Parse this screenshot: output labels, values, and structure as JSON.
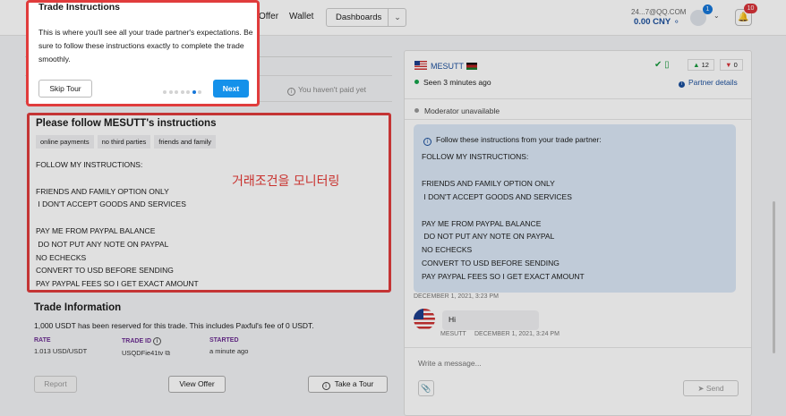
{
  "topbar": {
    "nav_offer": "Offer",
    "nav_wallet": "Wallet",
    "dashboards_label": "Dashboards",
    "account": "24...7@QQ.COM",
    "balance": "0.00 CNY",
    "avatar_badge": "1",
    "notifications_badge": "10"
  },
  "left": {
    "unpaid": "You haven't paid yet",
    "instructions_title": "Please follow MESUTT's instructions",
    "tags": [
      "online payments",
      "no third parties",
      "friends and family"
    ],
    "instructions_text": "FOLLOW MY INSTRUCTIONS:\n\nFRIENDS AND FAMILY OPTION ONLY\n I DON'T ACCEPT GOODS AND SERVICES\n\nPAY ME FROM PAYPAL BALANCE\n DO NOT PUT ANY NOTE ON PAYPAL\nNO ECHECKS\nCONVERT TO USD BEFORE SENDING\nPAY PAYPAL FEES SO I GET EXACT AMOUNT",
    "annotation": "거래조건을 모니터링",
    "trade_info_title": "Trade Information",
    "trade_info_desc": "1,000 USDT has been reserved for this trade. This includes Paxful's fee of 0 USDT.",
    "rate_label": "RATE",
    "rate_value": "1.013 USD/USDT",
    "trade_id_label": "TRADE ID",
    "trade_id_value": "USQDFie41tv",
    "started_label": "STARTED",
    "started_value": "a minute ago",
    "report_btn": "Report",
    "view_offer_btn": "View Offer",
    "take_tour_btn": "Take a Tour"
  },
  "right": {
    "partner_name": "MESUTT",
    "seen": "Seen 3 minutes ago",
    "thumbs_up": "12",
    "thumbs_down": "0",
    "partner_details": "Partner details",
    "moderator": "Moderator unavailable",
    "chat_header": "Follow these instructions from your trade partner:",
    "chat_body": "FOLLOW MY INSTRUCTIONS:\n\nFRIENDS AND FAMILY OPTION ONLY\n I DON'T ACCEPT GOODS AND SERVICES\n\nPAY ME FROM PAYPAL BALANCE\n DO NOT PUT ANY NOTE ON PAYPAL\nNO ECHECKS\nCONVERT TO USD BEFORE SENDING\nPAY PAYPAL FEES SO I GET EXACT AMOUNT",
    "chat_timestamp": "DECEMBER 1, 2021, 3:23 PM",
    "message_text": "Hi",
    "message_sender": "MESUTT",
    "message_time": "DECEMBER 1, 2021, 3:24 PM",
    "compose_placeholder": "Write a message...",
    "send_btn": "Send"
  },
  "tour": {
    "title": "Trade Instructions",
    "text": "This is where you'll see all your trade partner's expectations. Be sure to follow these instructions exactly to complete the trade smoothly.",
    "skip_btn": "Skip Tour",
    "next_btn": "Next",
    "step": 6,
    "total_steps": 7
  },
  "colors": {
    "accent": "#1591ea",
    "highlight": "#e03c3c",
    "link": "#1b4f9c"
  }
}
